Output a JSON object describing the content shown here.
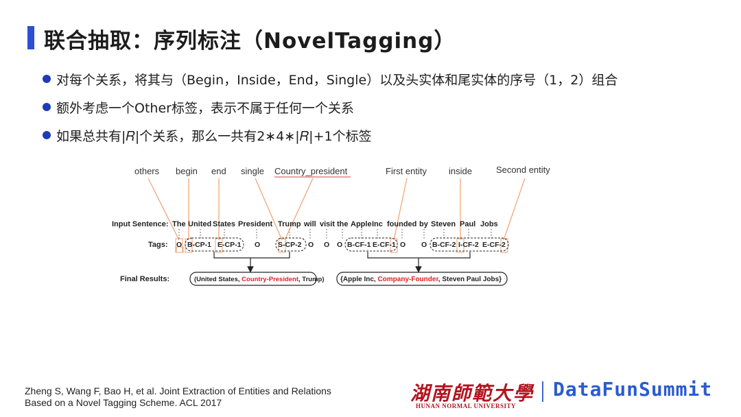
{
  "header": {
    "title": "联合抽取：序列标注（NovelTagging）"
  },
  "bullets": [
    {
      "text": "对每个关系，将其与（Begin，Inside，End，Single）以及头实体和尾实体的序号（1，2）组合"
    },
    {
      "text": "额外考虑一个Other标签，表示不属于任何一个关系"
    },
    {
      "text": "如果总共有|𝑅|个关系，那么一共有2∗4∗|𝑅|+1个标签"
    }
  ],
  "figure": {
    "labels": {
      "others": "others",
      "begin": "begin",
      "end": "end",
      "single": "single",
      "country_president": "Country_president",
      "first_entity": "First entity",
      "inside": "inside",
      "second_entity": "Second entity"
    },
    "input_label": "Input Sentence:",
    "words": [
      "The",
      "United",
      "States",
      "President",
      "Trump",
      "will",
      "visit",
      "the",
      "Apple",
      "Inc",
      "founded",
      "by",
      "Steven",
      "Paul",
      "Jobs"
    ],
    "tags_label": "Tags:",
    "tags": [
      "O",
      "B-CP-1",
      "E-CP-1",
      "O",
      "S-CP-2",
      "O",
      "O",
      "O",
      "B-CF-1",
      "E-CF-1",
      "O",
      "O",
      "B-CF-2",
      "I-CF-2",
      "E-CF-2"
    ],
    "final_label": "Final Results:",
    "result1": {
      "open": "(United States, ",
      "relation": "Country-President",
      "close": ", Trump)"
    },
    "result2": {
      "open": "{Apple Inc, ",
      "relation": "Company-Founder",
      "close": ", Steven Paul Jobs}"
    },
    "colors": {
      "accent_orange": "#f0a070",
      "relation_red": "#e02020",
      "underline": "#d04040"
    }
  },
  "citation": {
    "line1": "Zheng S, Wang F, Bao H, et al. Joint Extraction of Entities and Relations",
    "line2": "Based on a Novel Tagging Scheme. ACL 2017"
  },
  "logos": {
    "university_cn": "湖南師範大學",
    "university_en": "HUNAN NORMAL UNIVERSITY",
    "brand": "DataFunSummit"
  }
}
